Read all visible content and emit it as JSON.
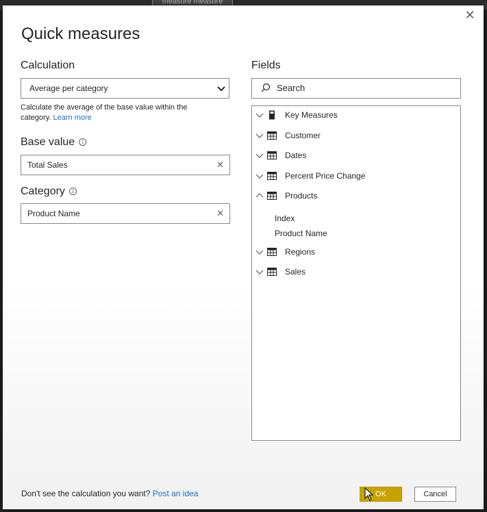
{
  "background_fragment": "measure measure",
  "dialog": {
    "title": "Quick measures",
    "close_glyph": "✕",
    "calculation": {
      "label": "Calculation",
      "selected": "Average per category",
      "description": "Calculate the average of the base value within the category.",
      "learn_more": "Learn more"
    },
    "base_value": {
      "label": "Base value",
      "value": "Total Sales"
    },
    "category": {
      "label": "Category",
      "value": "Product Name"
    },
    "fields": {
      "label": "Fields",
      "search_placeholder": "Search",
      "items": [
        {
          "label": "Key Measures",
          "icon": "calculator-icon",
          "expanded": false
        },
        {
          "label": "Customer",
          "icon": "table-icon",
          "expanded": false
        },
        {
          "label": "Dates",
          "icon": "table-icon",
          "expanded": false
        },
        {
          "label": "Percent Price Change",
          "icon": "table-icon",
          "expanded": false
        },
        {
          "label": "Products",
          "icon": "table-icon",
          "expanded": true,
          "children": [
            "Index",
            "Product Name"
          ]
        },
        {
          "label": "Regions",
          "icon": "table-icon",
          "expanded": false
        },
        {
          "label": "Sales",
          "icon": "table-icon",
          "expanded": false
        }
      ]
    },
    "footer": {
      "prompt": "Don't see the calculation you want?",
      "link": "Post an idea",
      "ok": "OK",
      "cancel": "Cancel"
    }
  },
  "colors": {
    "accent_ok": "#c8a200",
    "link": "#1a6fbf",
    "border": "#8a8886"
  }
}
